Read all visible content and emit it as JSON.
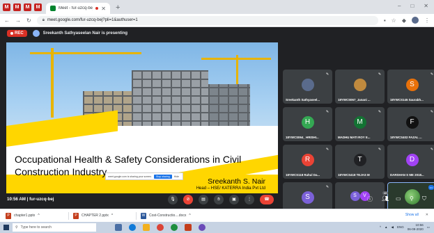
{
  "browser": {
    "tab_title": "Meet - fur-uzcq-bej",
    "url": "meet.google.com/fur-uzcq-bej?pli=1&authuser=1",
    "new_tab": "+",
    "window_controls": [
      "–",
      "□",
      "✕"
    ]
  },
  "meet": {
    "rec_label": "REC",
    "presenting_text": "Sreekanth Sathyaseelan Nair is presenting",
    "meeting_info": "10:56 AM  |  fur-uzcq-bej",
    "people_count": "40",
    "accent": "#8ab4f8",
    "end_call_color": "#ea4335"
  },
  "slide": {
    "title": "Occupational Health & Safety Considerations in Civil Construction Industry",
    "author": "Sreekanth S. Nair",
    "role": "Head – HSE/ KATERRA India Pvt Ltd",
    "share_notice": "meet.google.com is sharing your screen.",
    "stop_sharing": "Stop sharing",
    "hide": "Hide"
  },
  "tiles": [
    {
      "name": "Sreekanth Sathyaseel...",
      "initial": "",
      "color": "#5a6b8c",
      "kind": "photo"
    },
    {
      "name": "18YWCS067_Janani ...",
      "initial": "",
      "color": "#c08a3e",
      "kind": "photo"
    },
    {
      "name": "18YWCS145 Saurabh...",
      "initial": "S",
      "color": "#e8710a"
    },
    {
      "name": "18YWCS064_ HRISHI...",
      "initial": "H",
      "color": "#34a853"
    },
    {
      "name": "MADHU MATI ROY E...",
      "initial": "M",
      "color": "#137333"
    },
    {
      "name": "18YWCS402 FAZAL ...",
      "initial": "F",
      "color": "#111111"
    },
    {
      "name": "18YWCS118 Rahul Da...",
      "initial": "R",
      "color": "#ea4335"
    },
    {
      "name": "18YWCS418 TEJAS M",
      "initial": "T",
      "color": "#202124"
    },
    {
      "name": "DARSHAN S ME 2018...",
      "initial": "D",
      "color": "#a142f4"
    },
    {
      "name": "SIDDHARTH C SANG...",
      "initial": "S",
      "color": "#7b61d8"
    },
    {
      "name": "40 others",
      "initial": "",
      "color": "#5f6368",
      "kind": "others"
    },
    {
      "name": "You",
      "initial": "",
      "color": "#2f7a2c",
      "kind": "you"
    }
  ],
  "others_avatars": [
    "S",
    "V"
  ],
  "downloads": [
    {
      "name": "chapter1.pptx"
    },
    {
      "name": "CHAPTER 2.pptx"
    },
    {
      "name": "Cost-Constructio....docx"
    }
  ],
  "downloads_show_all": "Show all",
  "downloads_close": "✕",
  "taskbar": {
    "search_placeholder": "Type here to search",
    "language": "ENG",
    "time": "10:56",
    "date": "06-09-2020"
  }
}
